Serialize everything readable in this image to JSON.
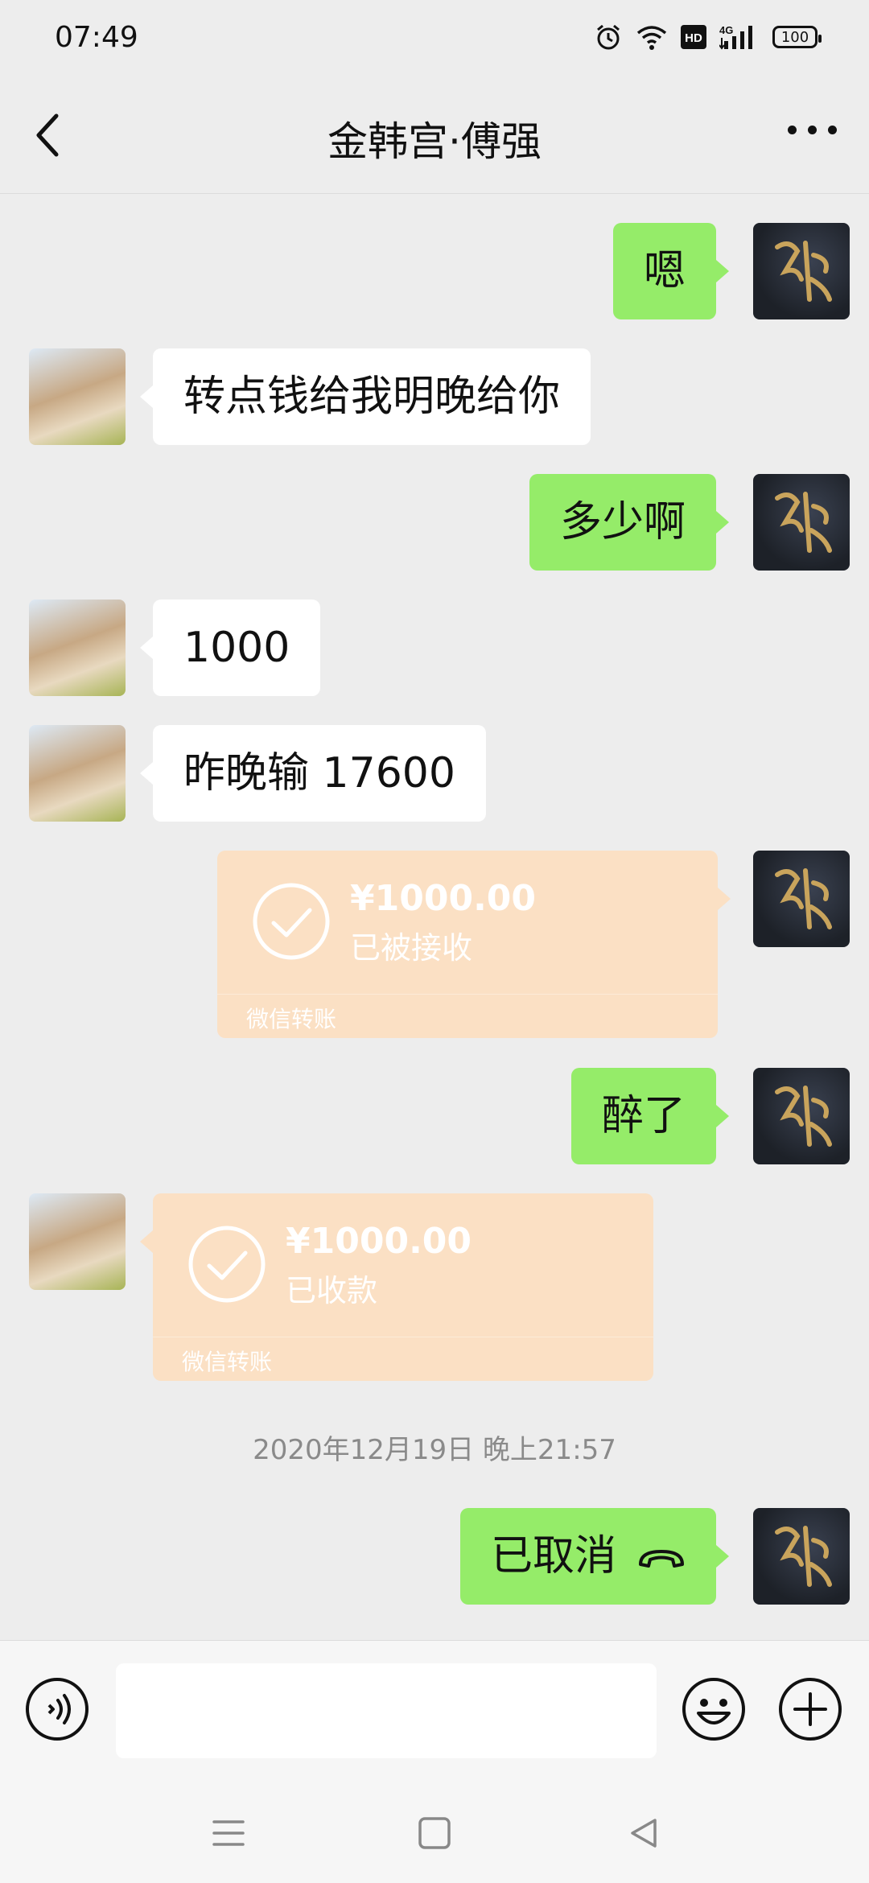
{
  "status_bar": {
    "time": "07:49",
    "icons": [
      "alarm-icon",
      "wifi-icon",
      "hd-icon",
      "4g-signal-icon",
      "battery-icon"
    ],
    "hd_label": "HD",
    "network_label": "4G",
    "battery": "100"
  },
  "header": {
    "title": "金韩宫·傅强",
    "back_icon": "back-icon",
    "more_icon": "more-icon"
  },
  "messages": [
    {
      "side": "sent",
      "type": "text",
      "text": "嗯"
    },
    {
      "side": "received",
      "type": "text",
      "text": "转点钱给我明晚给你"
    },
    {
      "side": "sent",
      "type": "text",
      "text": "多少啊"
    },
    {
      "side": "received",
      "type": "text",
      "text": "1000"
    },
    {
      "side": "received",
      "type": "text",
      "text": "昨晚输 17600"
    },
    {
      "side": "sent",
      "type": "transfer",
      "amount": "¥1000.00",
      "status": "已被接收",
      "label": "微信转账"
    },
    {
      "side": "sent",
      "type": "text",
      "text": "醉了"
    },
    {
      "side": "received",
      "type": "transfer",
      "amount": "¥1000.00",
      "status": "已收款",
      "label": "微信转账"
    },
    {
      "type": "timestamp",
      "text": "2020年12月19日 晚上21:57"
    },
    {
      "side": "sent",
      "type": "call",
      "text": "已取消",
      "icon": "hangup-icon"
    }
  ],
  "input_bar": {
    "voice_icon": "voice-icon",
    "emoji_icon": "emoji-icon",
    "plus_icon": "plus-icon",
    "input_value": ""
  },
  "colors": {
    "background": "#ededed",
    "sent_bubble": "#95ec69",
    "received_bubble": "#ffffff",
    "transfer_card": "#fbe0c4",
    "timestamp_text": "#8a8a8a"
  }
}
